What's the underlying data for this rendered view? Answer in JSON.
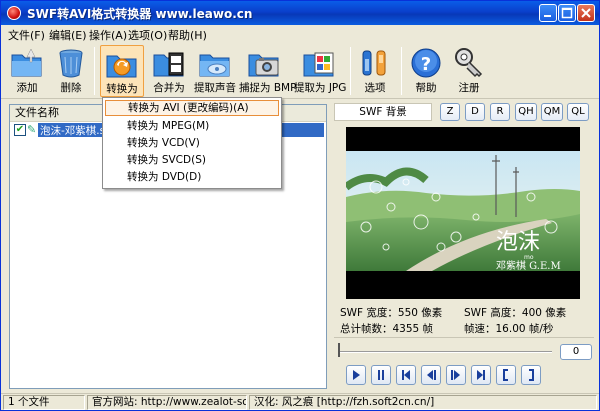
{
  "window": {
    "title": "SWF转AVI格式转换器 www.leawo.cn"
  },
  "menu": [
    "文件(F)",
    "编辑(E)",
    "操作(A)",
    "选项(O)",
    "帮助(H)"
  ],
  "toolbar": {
    "add": "添加",
    "delete": "删除",
    "convert": "转换为",
    "merge": "合并为",
    "extract_audio": "提取声音",
    "capture_bmp": "捕捉为 BMP",
    "extract_jpg": "提取为 JPG",
    "options": "选项",
    "help": "帮助",
    "register": "注册"
  },
  "filelist": {
    "column_header": "文件名称",
    "files": [
      {
        "name": "泡沫-邓紫棋.swf",
        "checked": true
      }
    ]
  },
  "context_menu": [
    "转换为 AVI (更改编码)(A)",
    "转换为 MPEG(M)",
    "转换为 VCD(V)",
    "转换为 SVCD(S)",
    "转换为 DVD(D)"
  ],
  "preview": {
    "tab": "SWF 背景",
    "zoom_buttons": [
      "Z",
      "D",
      "R",
      "QH",
      "QM",
      "QL"
    ],
    "video_text": {
      "title": "泡沫",
      "subtitle": "mo",
      "artist": "邓紫棋 G.E.M"
    },
    "width": "SWF 宽度：550 像素",
    "height": "SWF 高度：400 像素",
    "total_frames": "总计帧数：4355 帧",
    "frame_rate": "帧速：16.00 帧/秒",
    "current_frame": "0",
    "playback_position": 0
  },
  "status": {
    "count": "1 个文件",
    "website": "官方网站: http://www.zealot-soft.com",
    "translation": "汉化: 风之痕 [http://fzh.soft2cn.cn/]"
  },
  "icons": [
    "folder-add-icon",
    "trash-icon",
    "convert-icon",
    "merge-icon",
    "audio-folder-icon",
    "camera-icon",
    "jpg-folder-icon",
    "tools-icon",
    "help-icon",
    "key-icon"
  ]
}
